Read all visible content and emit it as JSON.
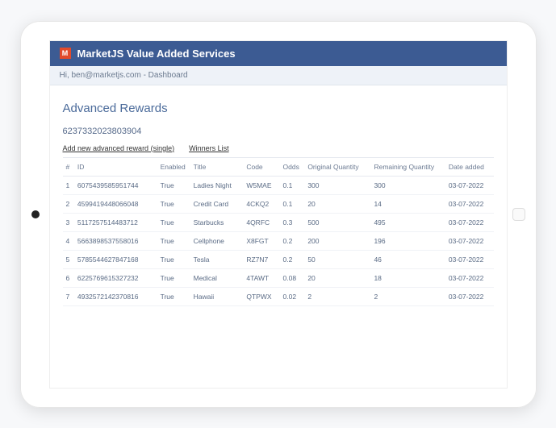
{
  "header": {
    "logo_text": "M",
    "title": "MarketJS Value Added Services"
  },
  "subheader": {
    "greeting": "Hi, ben@marketjs.com - Dashboard"
  },
  "page": {
    "title": "Advanced Rewards",
    "record_id": "6237332023803904"
  },
  "links": {
    "add_new": "Add new advanced reward (single)",
    "winners": "Winners List"
  },
  "table": {
    "headers": {
      "num": "#",
      "id": "ID",
      "enabled": "Enabled",
      "title": "Title",
      "code": "Code",
      "odds": "Odds",
      "orig_qty": "Original Quantity",
      "rem_qty": "Remaining Quantity",
      "date_added": "Date added"
    },
    "rows": [
      {
        "num": "1",
        "id": "6075439585951744",
        "enabled": "True",
        "title": "Ladies Night",
        "code": "W5MAE",
        "odds": "0.1",
        "orig_qty": "300",
        "rem_qty": "300",
        "date_added": "03-07-2022"
      },
      {
        "num": "2",
        "id": "4599419448066048",
        "enabled": "True",
        "title": "Credit Card",
        "code": "4CKQ2",
        "odds": "0.1",
        "orig_qty": "20",
        "rem_qty": "14",
        "date_added": "03-07-2022"
      },
      {
        "num": "3",
        "id": "5117257514483712",
        "enabled": "True",
        "title": "Starbucks",
        "code": "4QRFC",
        "odds": "0.3",
        "orig_qty": "500",
        "rem_qty": "495",
        "date_added": "03-07-2022"
      },
      {
        "num": "4",
        "id": "5663898537558016",
        "enabled": "True",
        "title": "Cellphone",
        "code": "X8FGT",
        "odds": "0.2",
        "orig_qty": "200",
        "rem_qty": "196",
        "date_added": "03-07-2022"
      },
      {
        "num": "5",
        "id": "5785544627847168",
        "enabled": "True",
        "title": "Tesla",
        "code": "RZ7N7",
        "odds": "0.2",
        "orig_qty": "50",
        "rem_qty": "46",
        "date_added": "03-07-2022"
      },
      {
        "num": "6",
        "id": "6225769615327232",
        "enabled": "True",
        "title": "Medical",
        "code": "4TAWT",
        "odds": "0.08",
        "orig_qty": "20",
        "rem_qty": "18",
        "date_added": "03-07-2022"
      },
      {
        "num": "7",
        "id": "4932572142370816",
        "enabled": "True",
        "title": "Hawaii",
        "code": "QTPWX",
        "odds": "0.02",
        "orig_qty": "2",
        "rem_qty": "2",
        "date_added": "03-07-2022"
      }
    ]
  }
}
